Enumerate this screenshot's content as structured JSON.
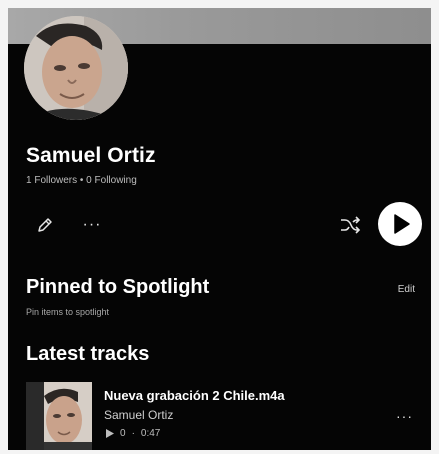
{
  "profile": {
    "name": "Samuel Ortiz",
    "stats": "1 Followers • 0 Following"
  },
  "actions": {
    "edit_icon": "pencil-icon",
    "more_icon": "ellipsis-icon",
    "more_label": "···",
    "shuffle_icon": "shuffle-icon",
    "play_icon": "play-icon"
  },
  "spotlight": {
    "title": "Pinned to Spotlight",
    "subtitle": "Pin items to spotlight",
    "edit_label": "Edit"
  },
  "latest": {
    "title": "Latest tracks",
    "tracks": [
      {
        "title": "Nueva grabación 2 Chile.m4a",
        "artist": "Samuel Ortiz",
        "plays": "0",
        "duration": "0:47",
        "more_label": "···"
      }
    ]
  },
  "colors": {
    "background": "#050505",
    "banner": "#9a9a9a",
    "text_secondary": "#bdbdbd",
    "button_fill": "#ffffff"
  }
}
